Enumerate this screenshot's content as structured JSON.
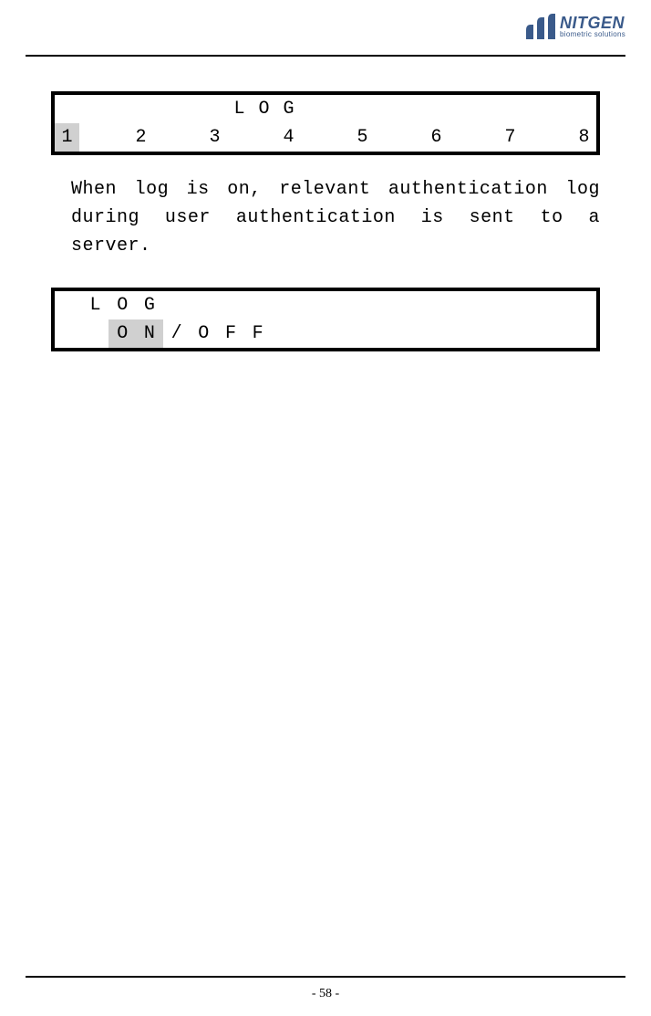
{
  "brand": {
    "name": "NITGEN",
    "tagline": "biometric solutions"
  },
  "lcd1": {
    "row1": [
      "",
      "",
      "",
      "",
      "",
      "",
      "",
      "L",
      "O",
      "G",
      "",
      "",
      "",
      "",
      "",
      "",
      "",
      "",
      "",
      ""
    ],
    "row2": [
      "1",
      "",
      "",
      "2",
      "",
      "",
      "3",
      "",
      "",
      "4",
      "",
      "",
      "5",
      "",
      "",
      "6",
      "",
      "",
      "7",
      "",
      "",
      "8"
    ],
    "row2_highlight": [
      0
    ]
  },
  "body_text": "When log is on, relevant authentication log during user authentication is sent to a server.",
  "lcd2": {
    "row1": [
      "",
      "L",
      "O",
      "G",
      "",
      "",
      "",
      "",
      "",
      "",
      "",
      "",
      "",
      "",
      "",
      "",
      "",
      "",
      "",
      ""
    ],
    "row2": [
      "",
      "",
      "O",
      "N",
      "/",
      "O",
      "F",
      "F",
      "",
      "",
      "",
      "",
      "",
      "",
      "",
      "",
      "",
      "",
      "",
      ""
    ],
    "row2_highlight": [
      2,
      3
    ]
  },
  "page_number": "- 58 -"
}
